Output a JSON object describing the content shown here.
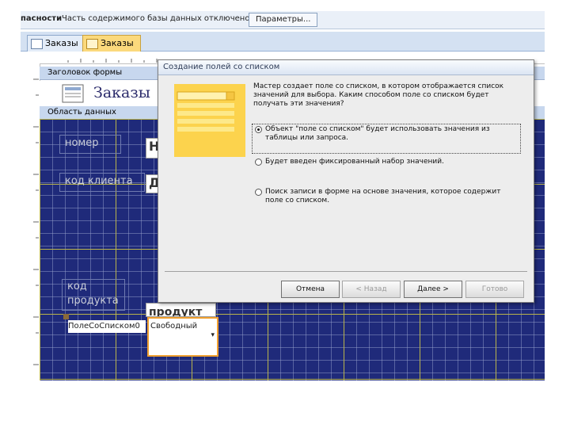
{
  "security_bar": {
    "label": "пасности",
    "message": "Часть содержимого базы данных отключено",
    "options_button": "Параметры..."
  },
  "tabs": [
    {
      "label": "Заказы",
      "active": false
    },
    {
      "label": "Заказы",
      "active": true
    }
  ],
  "sections": {
    "form_header": "Заголовок формы",
    "detail": "Область данных"
  },
  "form": {
    "header_title": "Заказы",
    "fields": [
      {
        "label": "номер",
        "value": "Н"
      },
      {
        "label": "код клиента",
        "value": "Д"
      },
      {
        "label": "код продукта",
        "value": "продукт"
      }
    ],
    "combo_caption": "ПолеСоСписком0",
    "combo_value": "Свободный",
    "combo_arrow": "▾"
  },
  "dialog": {
    "title": "Создание полей со списком",
    "intro": "Мастер создает поле со списком, в котором отображается список значений для выбора. Каким способом поле со списком будет получать эти значения?",
    "options": [
      {
        "text": "Объект \"поле со списком\" будет использовать значения из таблицы или запроса.",
        "selected": true
      },
      {
        "text": "Будет введен фиксированный набор значений.",
        "selected": false
      },
      {
        "text": "Поиск записи в форме на основе значения, которое содержит поле со списком.",
        "selected": false
      }
    ],
    "buttons": {
      "cancel": "Отмена",
      "back": "< Назад",
      "next": "Далее >",
      "finish": "Готово"
    }
  },
  "colors": {
    "detail_background": "#1f2a7a",
    "grid_line": "#b9b34a",
    "active_tab": "#fbd97c"
  }
}
